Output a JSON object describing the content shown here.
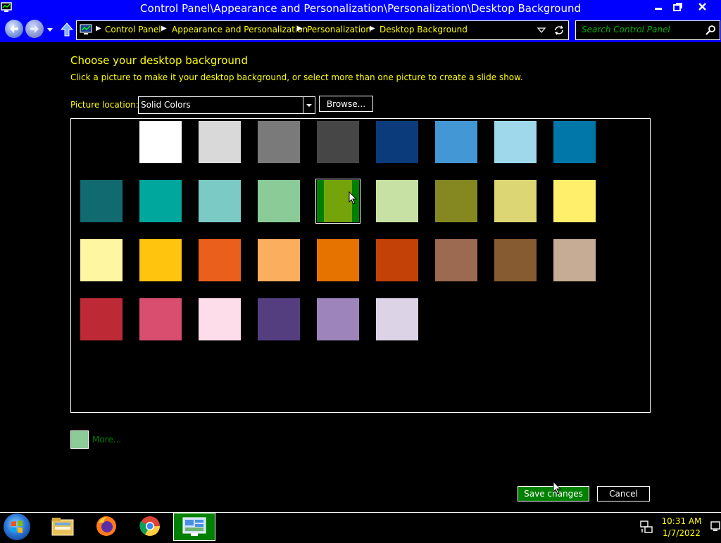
{
  "window": {
    "title": "Control Panel\\Appearance and Personalization\\Personalization\\Desktop Background"
  },
  "address_bar": {
    "breadcrumbs": [
      "Control Panel",
      "Appearance and Personalization",
      "Personalization",
      "Desktop Background"
    ],
    "search_placeholder": "Search Control Panel"
  },
  "content": {
    "heading": "Choose your desktop background",
    "subheading": "Click a picture to make it your desktop background, or select more than one picture to create a slide show.",
    "location_label": "Picture location:",
    "location_value": "Solid Colors",
    "browse_label": "Browse...",
    "more_label": "More...",
    "selected_swatch_index": 13
  },
  "swatches": [
    "#000000",
    "#ffffff",
    "#d9d9d9",
    "#7a7a7a",
    "#464646",
    "#0b3b7b",
    "#4397d4",
    "#9fd8ea",
    "#0077a8",
    "#116a70",
    "#00a79c",
    "#7ccac6",
    "#8bcb98",
    "#74a409",
    "#c7e0a3",
    "#858820",
    "#dcd774",
    "#ffef6a",
    "#fff6a2",
    "#ffc40d",
    "#ea5f1c",
    "#fcae5f",
    "#e67300",
    "#c34006",
    "#9c6a50",
    "#875b32",
    "#c6ac94",
    "#bd2a35",
    "#d94d6f",
    "#fcdde9",
    "#553e80",
    "#9d85bc",
    "#ddd3e7"
  ],
  "actions": {
    "save_label": "Save changes",
    "cancel_label": "Cancel"
  },
  "taskbar": {
    "time": "10:31 AM",
    "date": "1/7/2022"
  },
  "colors": {
    "titlebar": "#0000ff",
    "text_highlight": "#ffff00",
    "accent_green": "#008000"
  }
}
